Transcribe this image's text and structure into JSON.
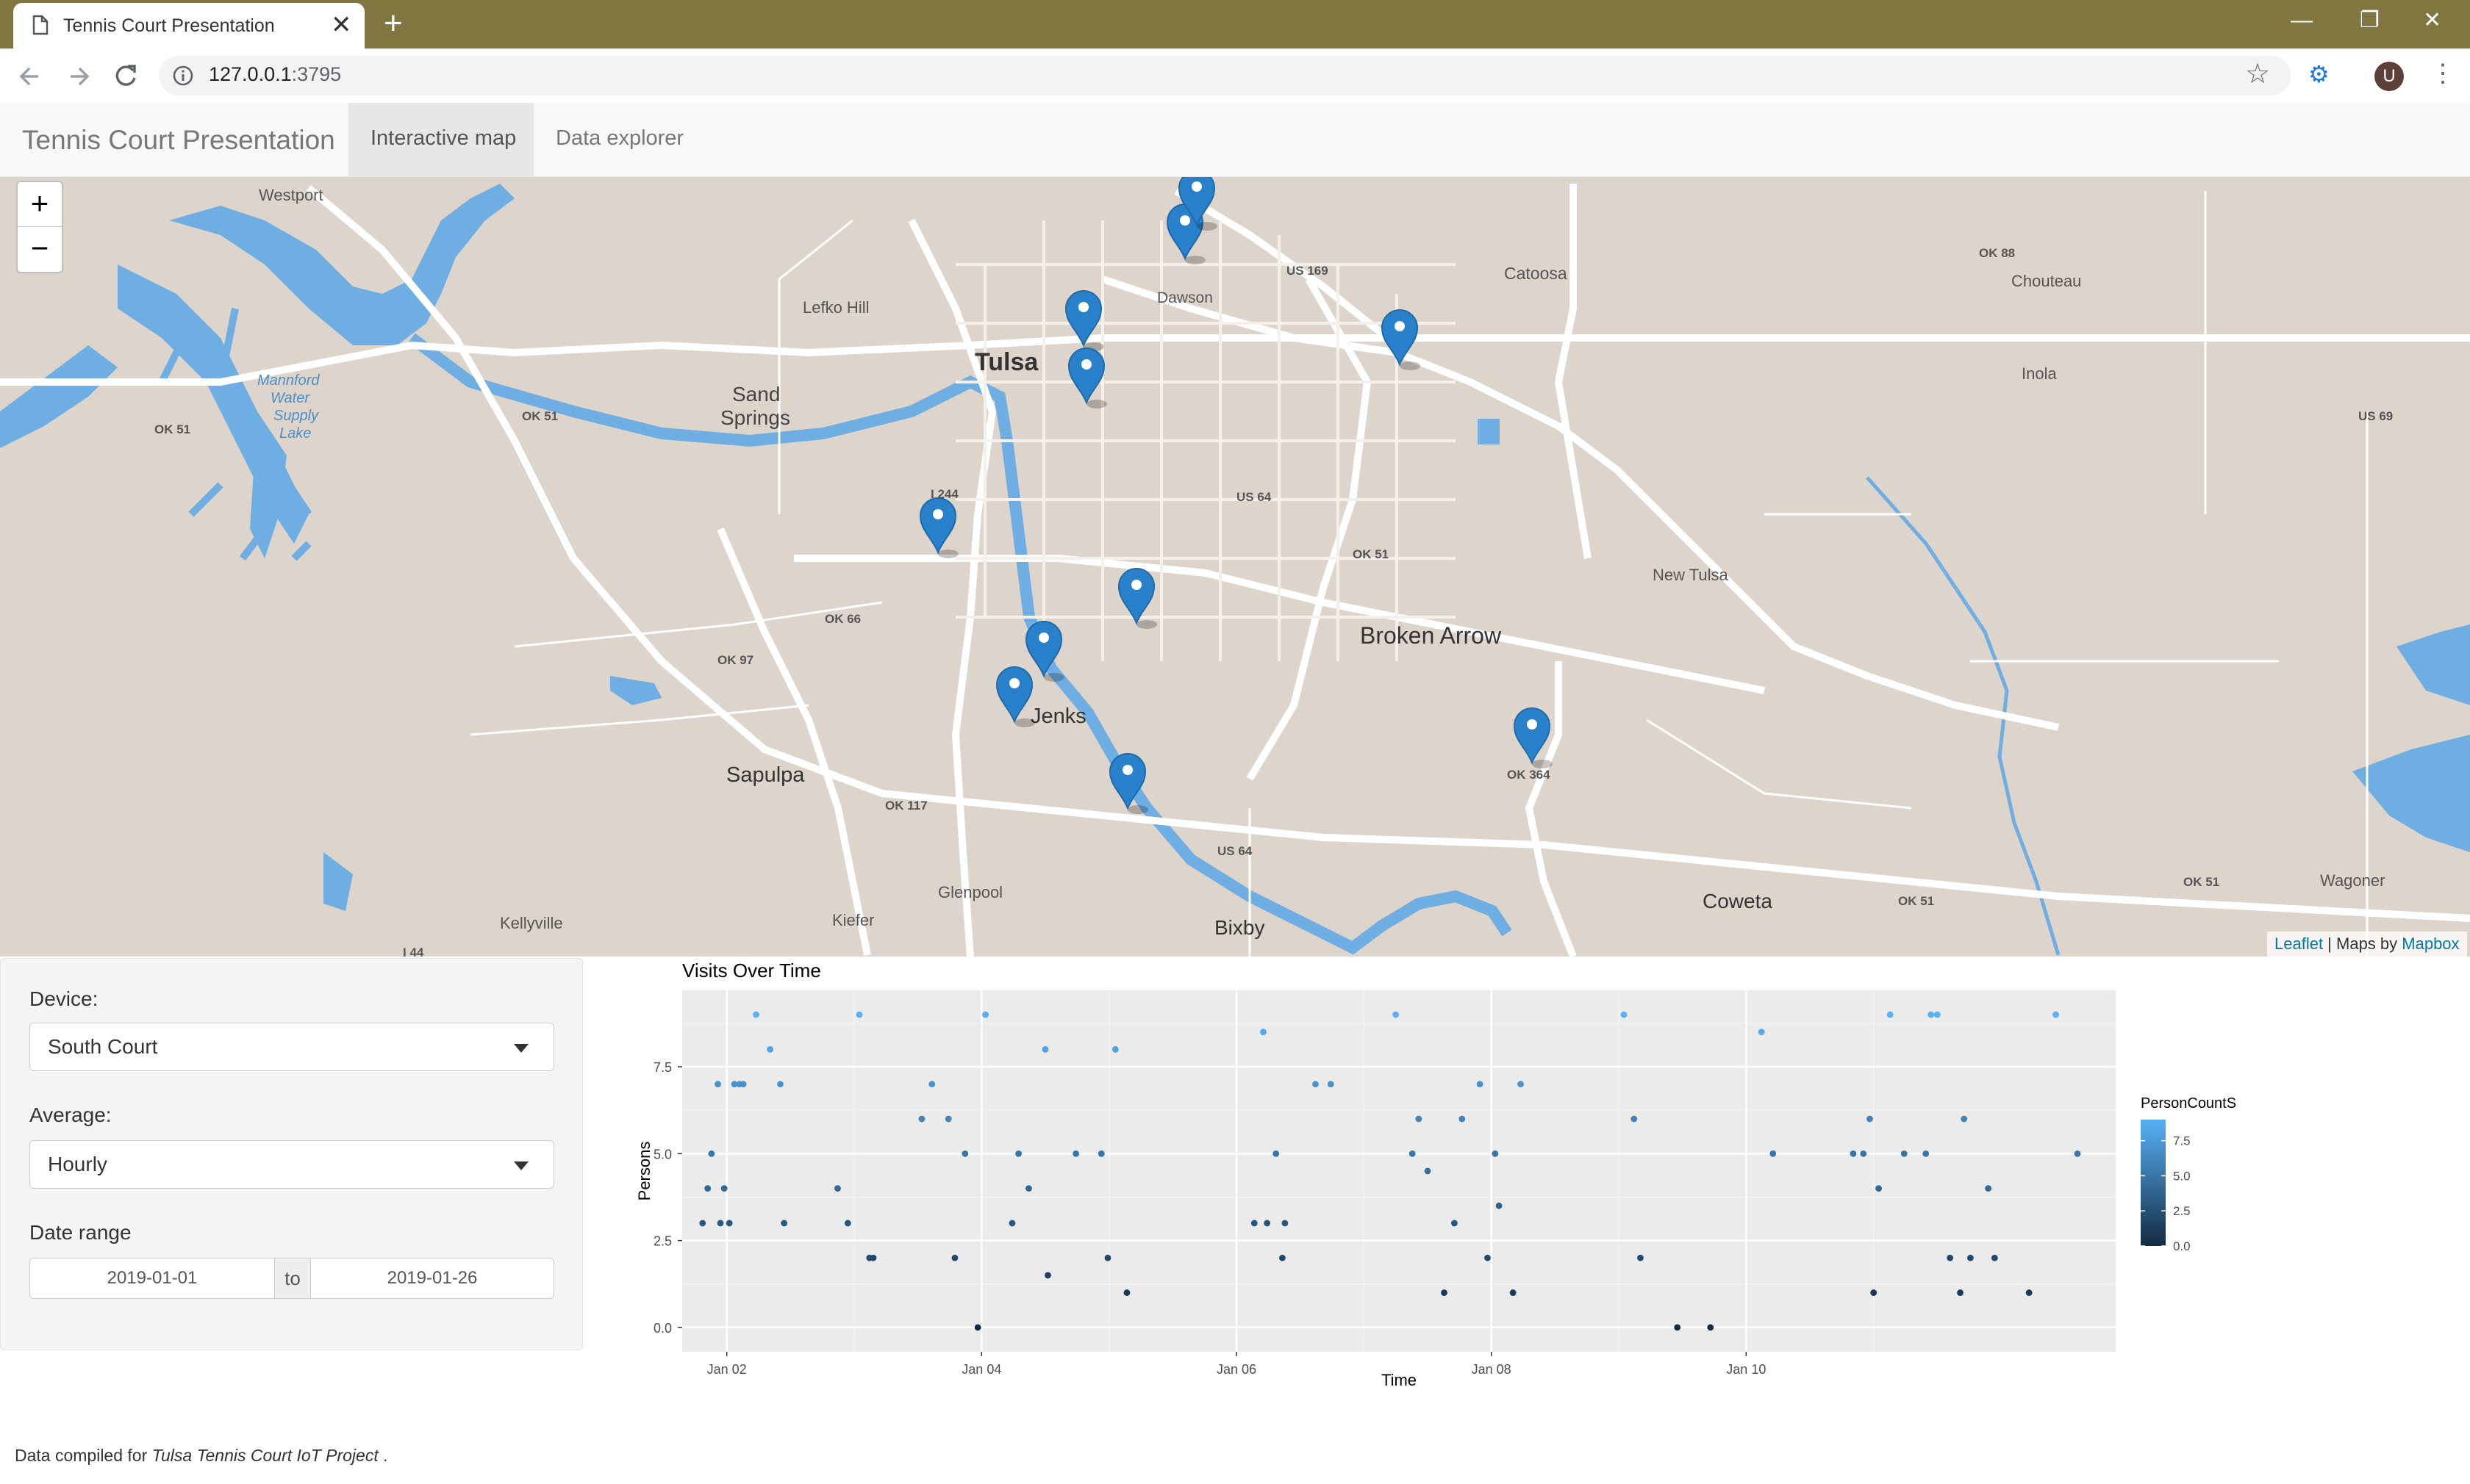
{
  "browser": {
    "tab_title": "Tennis Court Presentation",
    "url_host": "127.0.0.1",
    "url_port": ":3795",
    "profile_initial": "U"
  },
  "app": {
    "brand": "Tennis Court Presentation",
    "tabs": [
      {
        "label": "Interactive map",
        "active": true
      },
      {
        "label": "Data explorer",
        "active": false
      }
    ]
  },
  "map": {
    "zoom_in": "+",
    "zoom_out": "−",
    "attribution_leaflet": "Leaflet",
    "attribution_sep": " | Maps by ",
    "attribution_mapbox": "Mapbox",
    "places": [
      "Westport",
      "Lefko Hill",
      "Tulsa",
      "Dawson",
      "Catoosa",
      "Chouteau",
      "Inola",
      "Sand",
      "Springs",
      "Mannford",
      "Water",
      "Supply",
      "Lake",
      "New Tulsa",
      "Broken Arrow",
      "Jenks",
      "Sapulpa",
      "Glenpool",
      "Kiefer",
      "Kellyville",
      "Bixby",
      "Coweta",
      "Wagoner"
    ],
    "road_labels": [
      "OK 88",
      "US 169",
      "OK 51",
      "OK 51",
      "US 69",
      "I 244",
      "US 64",
      "OK 51",
      "OK 66",
      "OK 97",
      "OK 117",
      "US 64",
      "OK 51",
      "OK 51",
      "I 44",
      "OK 364"
    ],
    "marker_count": 11,
    "colors": {
      "land": "#ddd4cb",
      "water": "#6eaee3",
      "road": "#ffffff",
      "marker": "#2a81cb"
    }
  },
  "controls": {
    "device_label": "Device:",
    "device_value": "South Court",
    "average_label": "Average:",
    "average_value": "Hourly",
    "date_label": "Date range",
    "date_start": "2019-01-01",
    "date_sep": "to",
    "date_end": "2019-01-26"
  },
  "footer": {
    "prefix": "Data compiled for ",
    "project": "Tulsa Tennis Court IoT Project",
    "suffix": " ."
  },
  "chart_data": {
    "type": "scatter",
    "title": "Visits Over Time",
    "xlabel": "Time",
    "ylabel": "Persons",
    "x_tick_labels": [
      "Jan 02",
      "Jan 04",
      "Jan 06",
      "Jan 08",
      "Jan 10"
    ],
    "y_tick_labels": [
      "0.0",
      "2.5",
      "5.0",
      "7.5"
    ],
    "ylim": [
      -0.7,
      9.7
    ],
    "xlim": [
      0.65,
      11.9
    ],
    "grid": true,
    "legend": {
      "title": "PersonCountS",
      "ticks": [
        "7.5",
        "5.0",
        "2.5",
        "0.0"
      ],
      "position": "right",
      "color_low": "#132b43",
      "color_high": "#56b1f7"
    },
    "x_units": "days since Jan 01 (x=1 is Jan 02)",
    "points": [
      [
        0.81,
        3
      ],
      [
        0.85,
        4
      ],
      [
        0.88,
        5
      ],
      [
        0.93,
        7
      ],
      [
        0.95,
        3
      ],
      [
        0.98,
        4
      ],
      [
        1.02,
        3
      ],
      [
        1.06,
        7
      ],
      [
        1.1,
        7
      ],
      [
        1.13,
        7
      ],
      [
        1.23,
        9
      ],
      [
        1.34,
        8
      ],
      [
        1.42,
        7
      ],
      [
        1.45,
        3
      ],
      [
        1.87,
        4
      ],
      [
        1.95,
        3
      ],
      [
        2.04,
        9
      ],
      [
        2.12,
        2
      ],
      [
        2.15,
        2
      ],
      [
        2.53,
        6
      ],
      [
        2.61,
        7
      ],
      [
        2.74,
        6
      ],
      [
        2.79,
        2
      ],
      [
        2.87,
        5
      ],
      [
        2.97,
        0
      ],
      [
        3.03,
        9
      ],
      [
        3.24,
        3
      ],
      [
        3.29,
        5
      ],
      [
        3.37,
        4
      ],
      [
        3.5,
        8
      ],
      [
        3.52,
        1.5
      ],
      [
        3.74,
        5
      ],
      [
        3.94,
        5
      ],
      [
        3.99,
        2
      ],
      [
        4.05,
        8
      ],
      [
        4.14,
        1
      ],
      [
        5.14,
        3
      ],
      [
        5.21,
        8.5
      ],
      [
        5.24,
        3
      ],
      [
        5.31,
        5
      ],
      [
        5.36,
        2
      ],
      [
        5.38,
        3
      ],
      [
        5.62,
        7
      ],
      [
        5.74,
        7
      ],
      [
        6.25,
        9
      ],
      [
        6.38,
        5
      ],
      [
        6.43,
        6
      ],
      [
        6.5,
        4.5
      ],
      [
        6.63,
        1
      ],
      [
        6.71,
        3
      ],
      [
        6.77,
        6
      ],
      [
        6.91,
        7
      ],
      [
        6.97,
        2
      ],
      [
        7.03,
        5
      ],
      [
        7.06,
        3.5
      ],
      [
        7.17,
        1
      ],
      [
        7.23,
        7
      ],
      [
        8.04,
        9
      ],
      [
        8.12,
        6
      ],
      [
        8.17,
        2
      ],
      [
        8.46,
        0
      ],
      [
        8.72,
        0
      ],
      [
        9.12,
        8.5
      ],
      [
        9.21,
        5
      ],
      [
        9.84,
        5
      ],
      [
        9.92,
        5
      ],
      [
        9.97,
        6
      ],
      [
        10.0,
        1
      ],
      [
        10.04,
        4
      ],
      [
        10.13,
        9
      ],
      [
        10.24,
        5
      ],
      [
        10.41,
        5
      ],
      [
        10.45,
        9
      ],
      [
        10.5,
        9
      ],
      [
        10.6,
        2
      ],
      [
        10.68,
        1
      ],
      [
        10.71,
        6
      ],
      [
        10.76,
        2
      ],
      [
        10.9,
        4
      ],
      [
        10.95,
        2
      ],
      [
        11.22,
        1
      ],
      [
        11.43,
        9
      ],
      [
        11.6,
        5
      ]
    ]
  }
}
